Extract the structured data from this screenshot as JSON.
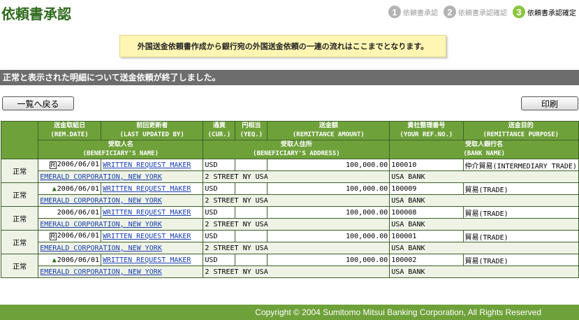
{
  "page": {
    "title": "依頼書承認"
  },
  "steps": [
    {
      "num": "1",
      "label": "依頼書承認"
    },
    {
      "num": "2",
      "label": "依頼書承認確認"
    },
    {
      "num": "3",
      "label": "依頼書承認確定"
    }
  ],
  "notice": "外国送金依頼書作成から銀行宛の外国送金依頼の一連の流れはここまでとなります。",
  "banner": "正常と表示された明細について送金依頼が終了しました。",
  "buttons": {
    "back": "一覧へ戻る",
    "print": "印刷"
  },
  "table": {
    "headers": {
      "date": [
        "送金取組日",
        "(REM.DATE)"
      ],
      "updated_by": [
        "前回更新者",
        "(LAST UPDATED BY)"
      ],
      "currency": [
        "通貨",
        "(CUR.)"
      ],
      "yen_eq": [
        "円相当",
        "(YEQ.)"
      ],
      "amount": [
        "送金額",
        "(REMITTANCE AMOUNT)"
      ],
      "ref_no": [
        "貴社整理番号",
        "(YOUR REF.NO.)"
      ],
      "purpose": [
        "送金目的",
        "(REMITTANCE PURPOSE)"
      ],
      "beneficiary_name": [
        "受取人名",
        "(BENEFICIARY'S NAME)"
      ],
      "beneficiary_address": [
        "受取人住所",
        "(BENEFICIARY'S ADDRESS)"
      ],
      "bank_name": [
        "受取人銀行名",
        "(BANK NAME)"
      ]
    },
    "rows": [
      {
        "status": "正常",
        "icon": "R",
        "date": "2006/06/01",
        "updated_by": "WRITTEN REQUEST MAKER",
        "currency": "USD",
        "yen_eq": "",
        "amount": "100,000.00",
        "ref_no": "100010",
        "purpose": "仲介貿易(INTERMEDIARY TRADE)",
        "beneficiary": "EMERALD CORPORATION, NEW YORK",
        "address": "2 STREET NY USA",
        "bank": "USA BANK"
      },
      {
        "status": "正常",
        "icon": "arrow",
        "date": "2006/06/01",
        "updated_by": "WRITTEN REQUEST MAKER",
        "currency": "USD",
        "yen_eq": "",
        "amount": "100,000.00",
        "ref_no": "100009",
        "purpose": "貿易(TRADE)",
        "beneficiary": "EMERALD CORPORATION, NEW YORK",
        "address": "2 STREET NY USA",
        "bank": "USA BANK"
      },
      {
        "status": "正常",
        "icon": "",
        "date": "2006/06/01",
        "updated_by": "WRITTEN REQUEST MAKER",
        "currency": "USD",
        "yen_eq": "",
        "amount": "100,000.00",
        "ref_no": "100008",
        "purpose": "貿易(TRADE)",
        "beneficiary": "EMERALD CORPORATION, NEW YORK",
        "address": "2 STREET NY USA",
        "bank": "USA BANK"
      },
      {
        "status": "正常",
        "icon": "R",
        "date": "2006/06/01",
        "updated_by": "WRITTEN REQUEST MAKER",
        "currency": "USD",
        "yen_eq": "",
        "amount": "100,000.00",
        "ref_no": "100001",
        "purpose": "貿易(TRADE)",
        "beneficiary": "EMERALD CORPORATION, NEW YORK",
        "address": "2 STREET NY USA",
        "bank": "USA BANK"
      },
      {
        "status": "正常",
        "icon": "arrow",
        "date": "2006/06/01",
        "updated_by": "WRITTEN REQUEST MAKER",
        "currency": "USD",
        "yen_eq": "",
        "amount": "100,000.00",
        "ref_no": "100002",
        "purpose": "貿易(TRADE)",
        "beneficiary": "EMERALD CORPORATION, NEW YORK",
        "address": "2 STREET NY USA",
        "bank": "USA BANK"
      }
    ]
  },
  "footer": "Copyright © 2004 Sumitomo Mitsui Banking Corporation, All Rights Reserved",
  "colors": {
    "header_green": "#6fa13a",
    "title_green": "#2f6a1d",
    "notice_bg": "#fff6b3",
    "banner_gray": "#6d6d6d"
  }
}
